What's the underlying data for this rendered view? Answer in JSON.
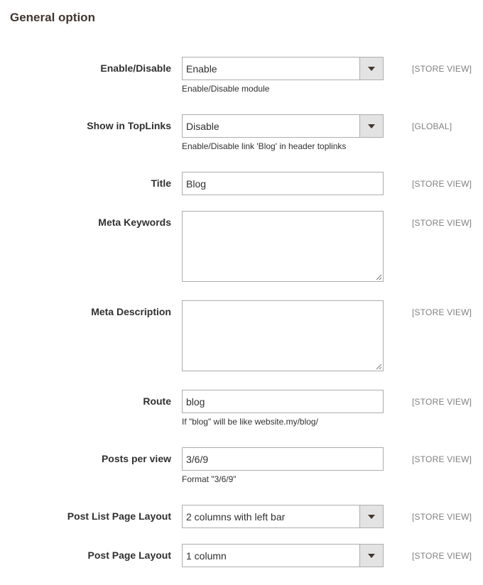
{
  "section": {
    "title": "General option"
  },
  "fields": {
    "enable": {
      "label": "Enable/Disable",
      "value": "Enable",
      "note": "Enable/Disable module",
      "scope": "[STORE VIEW]"
    },
    "toplinks": {
      "label": "Show in TopLinks",
      "value": "Disable",
      "note": "Enable/Disable link 'Blog' in header toplinks",
      "scope": "[GLOBAL]"
    },
    "title": {
      "label": "Title",
      "value": "Blog",
      "scope": "[STORE VIEW]"
    },
    "meta_keywords": {
      "label": "Meta Keywords",
      "value": "",
      "scope": "[STORE VIEW]"
    },
    "meta_description": {
      "label": "Meta Description",
      "value": "",
      "scope": "[STORE VIEW]"
    },
    "route": {
      "label": "Route",
      "value": "blog",
      "note": "If \"blog\" will be like website.my/blog/",
      "scope": "[STORE VIEW]"
    },
    "posts_per_view": {
      "label": "Posts per view",
      "value": "3/6/9",
      "note": "Format \"3/6/9\"",
      "scope": "[STORE VIEW]"
    },
    "post_list_layout": {
      "label": "Post List Page Layout",
      "value": "2 columns with left bar",
      "scope": "[STORE VIEW]"
    },
    "post_page_layout": {
      "label": "Post Page Layout",
      "value": "1 column",
      "scope": "[STORE VIEW]"
    }
  }
}
